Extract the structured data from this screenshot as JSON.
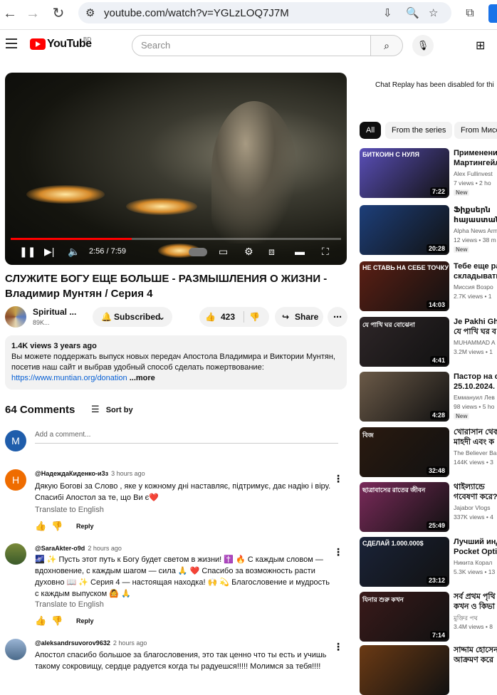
{
  "browser": {
    "url": "youtube.com/watch?v=YGLzLOQ7J7M"
  },
  "header": {
    "logo_text": "YouTube",
    "country": "BD",
    "search_placeholder": "Search"
  },
  "player": {
    "time": "2:56 / 7:59",
    "progress_fraction": 0.367
  },
  "video": {
    "title_line1": "СЛУЖИТЕ БОГУ ЕЩЕ БОЛЬШЕ - РАЗМЫШЛЕНИЯ О ЖИЗНИ -",
    "title_line2": "Владимир Мунтян / Серия 4",
    "channel_name": "Spiritual ...",
    "channel_subs": "89K...",
    "subscribed_label": "Subscribed",
    "likes": "423",
    "share_label": "Share"
  },
  "description": {
    "meta": "1.4K views  3 years ago",
    "text": "Вы можете поддержать выпуск новых передач Апостола Владимира и Виктории Мунтян, посетив наш сайт и выбрав удобный способ сделать пожертвование:",
    "link": "https://www.muntian.org/donation",
    "more": "...more"
  },
  "comments": {
    "count_label": "64 Comments",
    "sort_label": "Sort by",
    "my_initial": "M",
    "add_placeholder": "Add a comment...",
    "translate_label": "Translate to English",
    "reply_label": "Reply",
    "items": [
      {
        "initial": "H",
        "handle": "@НадеждаКиденко-и3з",
        "time": "3 hours ago",
        "text": "Дякую Богові за Слово , яке у кожному дні наставляє, підтримує, дає надію і віру. Спасибі Апостол за те, що Ви є❤️"
      },
      {
        "initial": "",
        "handle": "@SaraAkter-o9d",
        "time": "2 hours ago",
        "text": "🌌 ✨ Пусть этот путь к Богу будет светом в жизни! ✝️ 🔥 С каждым словом — вдохновение, с каждым шагом — сила 🙏 ❤️ Спасибо за возможность расти духовно 📖 ✨ Серия 4 — настоящая находка! 🙌 💫 Благословение и мудрость с каждым выпуском 🙆 🙏"
      },
      {
        "initial": "",
        "handle": "@aleksandrsuvorov9632",
        "time": "2 hours ago",
        "text": "Апостол спасибо большое за благословения, это так ценно что ты есть и учишь такому сокровищу, сердце радуется когда ты радуешся!!!!! Молимся за тебя!!!!"
      }
    ]
  },
  "sidebar": {
    "chat_replay": "Chat Replay has been disabled for thi",
    "chips": [
      "All",
      "From the series",
      "From Мисс"
    ],
    "recommendations": [
      {
        "thumb_text": "БИТКОИН С НУЛЯ",
        "duration": "7:22",
        "title1": "Применение",
        "title2": "Мартингейл",
        "channel": "Alex Fullinvest",
        "meta": "7 views • 2 ho",
        "new": "New",
        "color": "#5a4fb8"
      },
      {
        "thumb_text": "",
        "duration": "20:28",
        "title1": "Ֆիքսերն",
        "title2": "հայաստանի",
        "channel": "Alpha News Arm",
        "meta": "12 views • 38 m",
        "new": "New",
        "color": "#1d3f7a"
      },
      {
        "thumb_text": "НЕ СТАВЬ НА СЕБЕ ТОЧКУ",
        "duration": "14:03",
        "title1": "Тебе еще ра",
        "title2": "складывать",
        "channel": "Миссия Возро",
        "meta": "2.7K views • 1",
        "new": "",
        "color": "#5b1f14"
      },
      {
        "thumb_text": "যে পাখি ঘর বোঝেনা",
        "duration": "4:41",
        "title1": "Je Pakhi Gho",
        "title2": "যে পাখি ঘর ব",
        "channel": "MUHAMMAD A",
        "meta": "3.2M views • 1",
        "new": "",
        "color": "#2e2628"
      },
      {
        "thumb_text": "",
        "duration": "4:28",
        "title1": "Пастор на св",
        "title2": "25.10.2024.",
        "channel": "Еммануил Лев",
        "meta": "98 views • 5 ho",
        "new": "New",
        "color": "#6b5a48"
      },
      {
        "thumb_text": "বিজ",
        "duration": "32:48",
        "title1": "খোরাসান থেক",
        "title2": "মাহদী এবং ক",
        "channel": "The Believer Ba",
        "meta": "144K views • 3",
        "new": "",
        "color": "#2a1a10"
      },
      {
        "thumb_text": "ছাত্রাবাসের রাতের জীবন",
        "duration": "25:49",
        "title1": "থাইল্যান্ডে",
        "title2": "গবেষণা করে?",
        "channel": "Jajabor Vlogs",
        "meta": "337K views • 4",
        "new": "",
        "color": "#7a2a5a"
      },
      {
        "thumb_text": "СДЕЛАЙ 1.000.000$",
        "duration": "23:12",
        "title1": "Лучший инд",
        "title2": "Pocket Optio",
        "channel": "Никита Корал",
        "meta": "5.3K views • 13",
        "new": "",
        "color": "#1a2338"
      },
      {
        "thumb_text": "যিনার শুরু কখন",
        "duration": "7:14",
        "title1": "সর্ব প্রথম পৃথি",
        "title2": "কখন ও কিভা",
        "channel": "মুক্তির পথ",
        "meta": "3.4M views • 8",
        "new": "",
        "color": "#3a1a1a"
      },
      {
        "thumb_text": "",
        "duration": "",
        "title1": "সাদ্দাম হোসেন",
        "title2": "আক্রমণ করে",
        "channel": "",
        "meta": "",
        "new": "",
        "color": "#6b3a14"
      }
    ]
  }
}
